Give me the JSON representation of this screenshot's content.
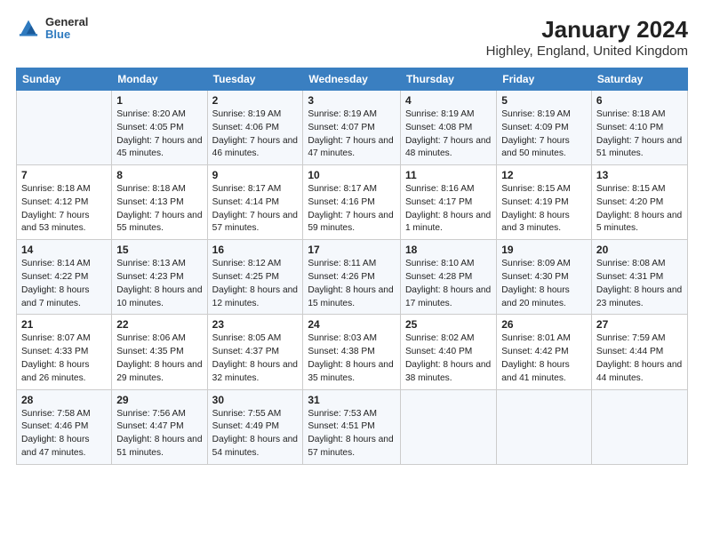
{
  "title": "January 2024",
  "subtitle": "Highley, England, United Kingdom",
  "logo": {
    "line1": "General",
    "line2": "Blue"
  },
  "headers": [
    "Sunday",
    "Monday",
    "Tuesday",
    "Wednesday",
    "Thursday",
    "Friday",
    "Saturday"
  ],
  "weeks": [
    [
      {
        "num": "",
        "sunrise": "",
        "sunset": "",
        "daylight": ""
      },
      {
        "num": "1",
        "sunrise": "Sunrise: 8:20 AM",
        "sunset": "Sunset: 4:05 PM",
        "daylight": "Daylight: 7 hours and 45 minutes."
      },
      {
        "num": "2",
        "sunrise": "Sunrise: 8:19 AM",
        "sunset": "Sunset: 4:06 PM",
        "daylight": "Daylight: 7 hours and 46 minutes."
      },
      {
        "num": "3",
        "sunrise": "Sunrise: 8:19 AM",
        "sunset": "Sunset: 4:07 PM",
        "daylight": "Daylight: 7 hours and 47 minutes."
      },
      {
        "num": "4",
        "sunrise": "Sunrise: 8:19 AM",
        "sunset": "Sunset: 4:08 PM",
        "daylight": "Daylight: 7 hours and 48 minutes."
      },
      {
        "num": "5",
        "sunrise": "Sunrise: 8:19 AM",
        "sunset": "Sunset: 4:09 PM",
        "daylight": "Daylight: 7 hours and 50 minutes."
      },
      {
        "num": "6",
        "sunrise": "Sunrise: 8:18 AM",
        "sunset": "Sunset: 4:10 PM",
        "daylight": "Daylight: 7 hours and 51 minutes."
      }
    ],
    [
      {
        "num": "7",
        "sunrise": "Sunrise: 8:18 AM",
        "sunset": "Sunset: 4:12 PM",
        "daylight": "Daylight: 7 hours and 53 minutes."
      },
      {
        "num": "8",
        "sunrise": "Sunrise: 8:18 AM",
        "sunset": "Sunset: 4:13 PM",
        "daylight": "Daylight: 7 hours and 55 minutes."
      },
      {
        "num": "9",
        "sunrise": "Sunrise: 8:17 AM",
        "sunset": "Sunset: 4:14 PM",
        "daylight": "Daylight: 7 hours and 57 minutes."
      },
      {
        "num": "10",
        "sunrise": "Sunrise: 8:17 AM",
        "sunset": "Sunset: 4:16 PM",
        "daylight": "Daylight: 7 hours and 59 minutes."
      },
      {
        "num": "11",
        "sunrise": "Sunrise: 8:16 AM",
        "sunset": "Sunset: 4:17 PM",
        "daylight": "Daylight: 8 hours and 1 minute."
      },
      {
        "num": "12",
        "sunrise": "Sunrise: 8:15 AM",
        "sunset": "Sunset: 4:19 PM",
        "daylight": "Daylight: 8 hours and 3 minutes."
      },
      {
        "num": "13",
        "sunrise": "Sunrise: 8:15 AM",
        "sunset": "Sunset: 4:20 PM",
        "daylight": "Daylight: 8 hours and 5 minutes."
      }
    ],
    [
      {
        "num": "14",
        "sunrise": "Sunrise: 8:14 AM",
        "sunset": "Sunset: 4:22 PM",
        "daylight": "Daylight: 8 hours and 7 minutes."
      },
      {
        "num": "15",
        "sunrise": "Sunrise: 8:13 AM",
        "sunset": "Sunset: 4:23 PM",
        "daylight": "Daylight: 8 hours and 10 minutes."
      },
      {
        "num": "16",
        "sunrise": "Sunrise: 8:12 AM",
        "sunset": "Sunset: 4:25 PM",
        "daylight": "Daylight: 8 hours and 12 minutes."
      },
      {
        "num": "17",
        "sunrise": "Sunrise: 8:11 AM",
        "sunset": "Sunset: 4:26 PM",
        "daylight": "Daylight: 8 hours and 15 minutes."
      },
      {
        "num": "18",
        "sunrise": "Sunrise: 8:10 AM",
        "sunset": "Sunset: 4:28 PM",
        "daylight": "Daylight: 8 hours and 17 minutes."
      },
      {
        "num": "19",
        "sunrise": "Sunrise: 8:09 AM",
        "sunset": "Sunset: 4:30 PM",
        "daylight": "Daylight: 8 hours and 20 minutes."
      },
      {
        "num": "20",
        "sunrise": "Sunrise: 8:08 AM",
        "sunset": "Sunset: 4:31 PM",
        "daylight": "Daylight: 8 hours and 23 minutes."
      }
    ],
    [
      {
        "num": "21",
        "sunrise": "Sunrise: 8:07 AM",
        "sunset": "Sunset: 4:33 PM",
        "daylight": "Daylight: 8 hours and 26 minutes."
      },
      {
        "num": "22",
        "sunrise": "Sunrise: 8:06 AM",
        "sunset": "Sunset: 4:35 PM",
        "daylight": "Daylight: 8 hours and 29 minutes."
      },
      {
        "num": "23",
        "sunrise": "Sunrise: 8:05 AM",
        "sunset": "Sunset: 4:37 PM",
        "daylight": "Daylight: 8 hours and 32 minutes."
      },
      {
        "num": "24",
        "sunrise": "Sunrise: 8:03 AM",
        "sunset": "Sunset: 4:38 PM",
        "daylight": "Daylight: 8 hours and 35 minutes."
      },
      {
        "num": "25",
        "sunrise": "Sunrise: 8:02 AM",
        "sunset": "Sunset: 4:40 PM",
        "daylight": "Daylight: 8 hours and 38 minutes."
      },
      {
        "num": "26",
        "sunrise": "Sunrise: 8:01 AM",
        "sunset": "Sunset: 4:42 PM",
        "daylight": "Daylight: 8 hours and 41 minutes."
      },
      {
        "num": "27",
        "sunrise": "Sunrise: 7:59 AM",
        "sunset": "Sunset: 4:44 PM",
        "daylight": "Daylight: 8 hours and 44 minutes."
      }
    ],
    [
      {
        "num": "28",
        "sunrise": "Sunrise: 7:58 AM",
        "sunset": "Sunset: 4:46 PM",
        "daylight": "Daylight: 8 hours and 47 minutes."
      },
      {
        "num": "29",
        "sunrise": "Sunrise: 7:56 AM",
        "sunset": "Sunset: 4:47 PM",
        "daylight": "Daylight: 8 hours and 51 minutes."
      },
      {
        "num": "30",
        "sunrise": "Sunrise: 7:55 AM",
        "sunset": "Sunset: 4:49 PM",
        "daylight": "Daylight: 8 hours and 54 minutes."
      },
      {
        "num": "31",
        "sunrise": "Sunrise: 7:53 AM",
        "sunset": "Sunset: 4:51 PM",
        "daylight": "Daylight: 8 hours and 57 minutes."
      },
      {
        "num": "",
        "sunrise": "",
        "sunset": "",
        "daylight": ""
      },
      {
        "num": "",
        "sunrise": "",
        "sunset": "",
        "daylight": ""
      },
      {
        "num": "",
        "sunrise": "",
        "sunset": "",
        "daylight": ""
      }
    ]
  ]
}
